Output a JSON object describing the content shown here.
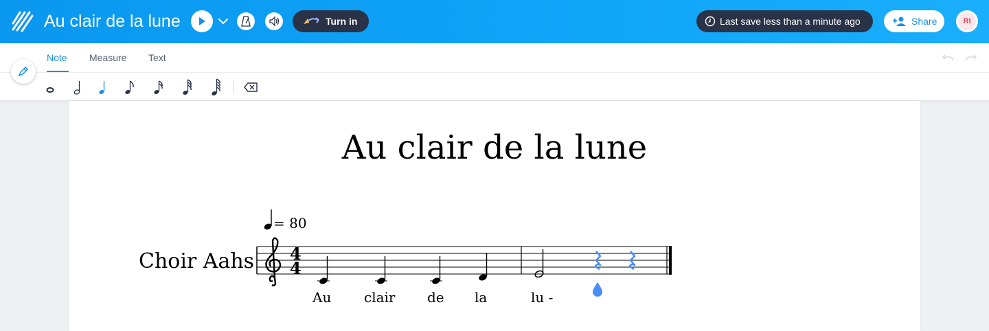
{
  "header": {
    "title": "Au clair de la lune",
    "turn_in_label": "Turn in",
    "last_save": "Last save less than a minute ago",
    "share_label": "Share",
    "avatar_initials": "RI"
  },
  "tabs": [
    {
      "label": "Note",
      "active": true
    },
    {
      "label": "Measure",
      "active": false
    },
    {
      "label": "Text",
      "active": false
    }
  ],
  "note_palette": [
    "whole-note-icon",
    "half-note-icon",
    "quarter-note-icon",
    "eighth-note-icon",
    "sixteenth-note-icon",
    "thirty-second-note-icon",
    "sixty-fourth-note-icon",
    "delete-note-icon"
  ],
  "selected_note": "quarter",
  "score": {
    "title": "Au clair de la lune",
    "instrument": "Choir Aahs",
    "tempo": "= 80",
    "time_signature": {
      "top": "4",
      "bottom": "4"
    },
    "clef": "treble",
    "lyrics": [
      "Au",
      "clair",
      "de",
      "la",
      "lu -"
    ]
  },
  "colors": {
    "accent": "#1a8fe6",
    "topbar": "#0a97f0",
    "selection": "#4a8ef7",
    "dark_pill": "#2a3248"
  }
}
